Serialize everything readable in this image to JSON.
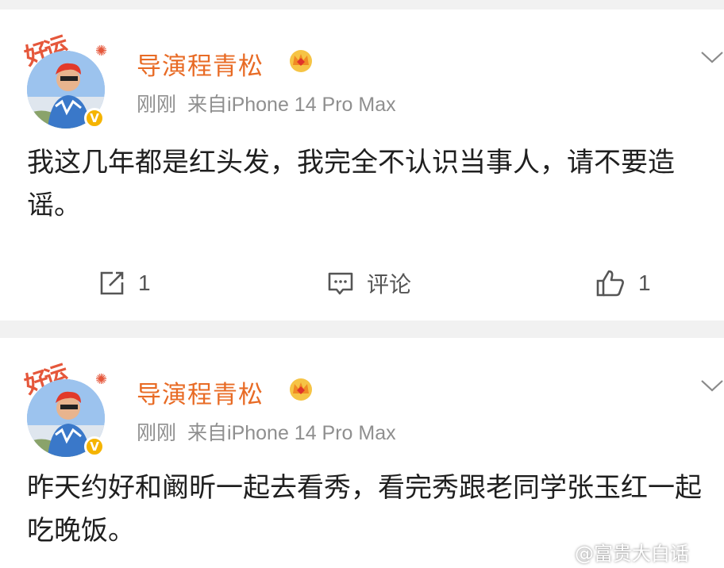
{
  "posts": [
    {
      "avatar_frame_text": "好运",
      "author": "导演程青松",
      "time": "刚刚",
      "source": "来自iPhone 14 Pro Max",
      "content": "我这几年都是红头发，我完全不认识当事人，请不要造谣。",
      "actions": {
        "repost_count": "1",
        "comment_label": "评论",
        "like_count": "1"
      }
    },
    {
      "avatar_frame_text": "好运",
      "author": "导演程青松",
      "time": "刚刚",
      "source": "来自iPhone 14 Pro Max",
      "content": "昨天约好和阚昕一起去看秀，看完秀跟老同学张玉红一起吃晚饭。"
    }
  ],
  "watermark": "@富贵大白话",
  "colors": {
    "author": "#e86b25",
    "verified": "#f5b400",
    "background": "#f1f1f1"
  }
}
